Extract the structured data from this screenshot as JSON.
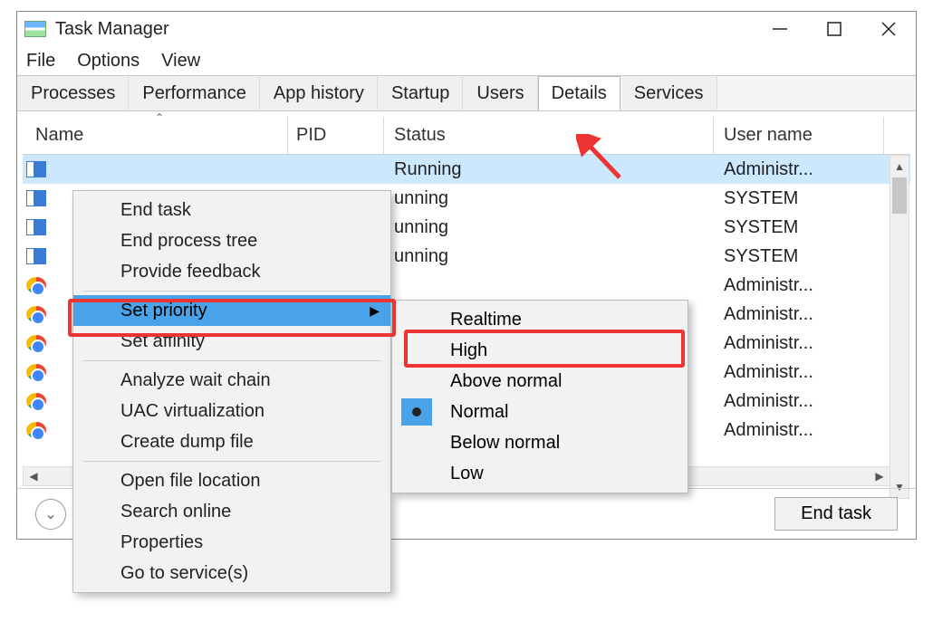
{
  "window": {
    "title": "Task Manager"
  },
  "menu": {
    "file": "File",
    "options": "Options",
    "view": "View"
  },
  "tabs": {
    "processes": "Processes",
    "performance": "Performance",
    "apphistory": "App history",
    "startup": "Startup",
    "users": "Users",
    "details": "Details",
    "services": "Services",
    "active": "details"
  },
  "columns": {
    "name": "Name",
    "pid": "PID",
    "status": "Status",
    "user": "User name"
  },
  "rows": [
    {
      "icon": "blue",
      "status": "Running",
      "user": "Administr..."
    },
    {
      "icon": "blue",
      "status": "unning",
      "user": "SYSTEM"
    },
    {
      "icon": "blue",
      "status": "unning",
      "user": "SYSTEM"
    },
    {
      "icon": "blue",
      "status": "unning",
      "user": "SYSTEM"
    },
    {
      "icon": "chrome",
      "status": "",
      "user": "Administr..."
    },
    {
      "icon": "chrome",
      "status": "",
      "user": "Administr..."
    },
    {
      "icon": "chrome",
      "status": "",
      "user": "Administr..."
    },
    {
      "icon": "chrome",
      "status": "",
      "user": "Administr..."
    },
    {
      "icon": "chrome",
      "status": "",
      "user": "Administr..."
    },
    {
      "icon": "chrome",
      "status": "",
      "user": "Administr..."
    }
  ],
  "context_menu": {
    "items": [
      {
        "label": "End task"
      },
      {
        "label": "End process tree"
      },
      {
        "label": "Provide feedback"
      },
      {
        "sep": true
      },
      {
        "label": "Set priority",
        "sub": true,
        "hov": true
      },
      {
        "label": "Set affinity"
      },
      {
        "sep": true
      },
      {
        "label": "Analyze wait chain"
      },
      {
        "label": "UAC virtualization"
      },
      {
        "label": "Create dump file"
      },
      {
        "sep": true
      },
      {
        "label": "Open file location"
      },
      {
        "label": "Search online"
      },
      {
        "label": "Properties"
      },
      {
        "label": "Go to service(s)"
      }
    ]
  },
  "submenu": {
    "items": [
      {
        "label": "Realtime"
      },
      {
        "label": "High",
        "highlight": true
      },
      {
        "label": "Above normal"
      },
      {
        "label": "Normal",
        "current": true
      },
      {
        "label": "Below normal"
      },
      {
        "label": "Low"
      }
    ]
  },
  "buttons": {
    "end_task": "End task"
  }
}
